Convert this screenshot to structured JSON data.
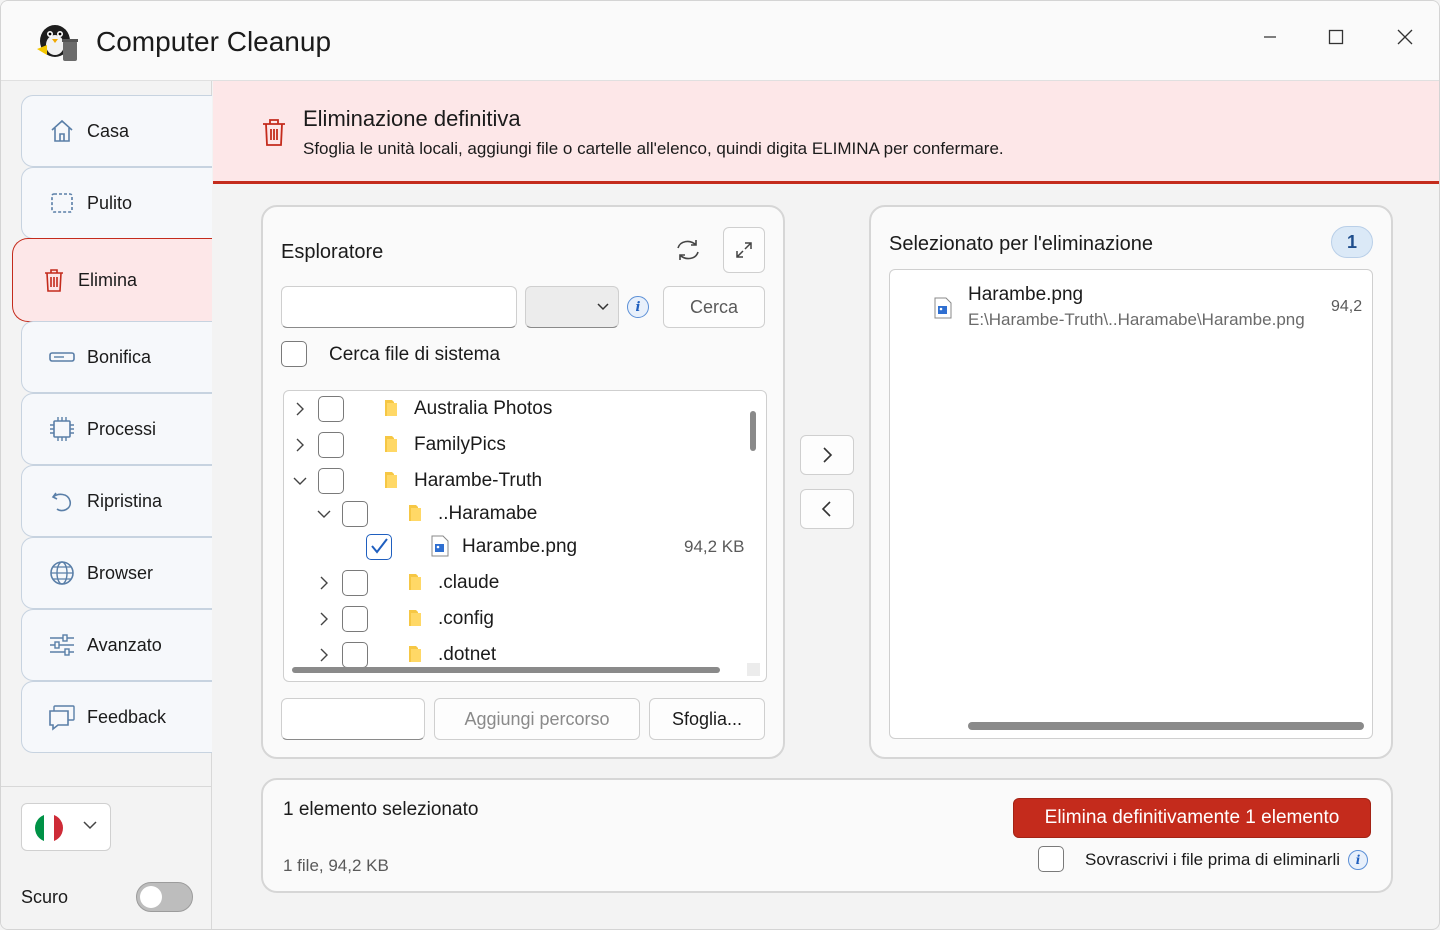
{
  "app": {
    "title": "Computer Cleanup",
    "window_controls": {
      "minimize": "minimize-icon",
      "maximize": "maximize-icon",
      "close": "close-icon"
    }
  },
  "sidebar": {
    "items": [
      {
        "label": "Casa",
        "icon": "home-icon"
      },
      {
        "label": "Pulito",
        "icon": "clean-icon"
      },
      {
        "label": "Elimina",
        "icon": "trash-icon",
        "active": true
      },
      {
        "label": "Bonifica",
        "icon": "drive-icon"
      },
      {
        "label": "Processi",
        "icon": "chip-icon"
      },
      {
        "label": "Ripristina",
        "icon": "restore-icon"
      },
      {
        "label": "Browser",
        "icon": "globe-icon"
      },
      {
        "label": "Avanzato",
        "icon": "sliders-icon"
      },
      {
        "label": "Feedback",
        "icon": "feedback-icon"
      }
    ],
    "language": {
      "selected": "it",
      "flag_icon": "italy-flag-icon"
    },
    "dark_mode": {
      "label": "Scuro",
      "on": false
    }
  },
  "banner": {
    "title": "Eliminazione definitiva",
    "subtitle": "Sfoglia le unità locali, aggiungi file o cartelle all'elenco, quindi digita ELIMINA per confermare.",
    "accent": "#c42b1c",
    "background": "#fde7e8"
  },
  "explorer": {
    "title": "Esploratore",
    "search_placeholder": "",
    "search_button": "Cerca",
    "system_files_label": "Cerca file di sistema",
    "tree": [
      {
        "label": "Australia Photos",
        "type": "folder",
        "expanded": false,
        "checked": false
      },
      {
        "label": "FamilyPics",
        "type": "folder",
        "expanded": false,
        "checked": false
      },
      {
        "label": "Harambe-Truth",
        "type": "folder",
        "expanded": true,
        "checked": false
      },
      {
        "label": "..Haramabe",
        "type": "folder",
        "expanded": true,
        "checked": false
      },
      {
        "label": "Harambe.png",
        "type": "file",
        "size": "94,2 KB",
        "checked": true
      },
      {
        "label": ".claude",
        "type": "folder",
        "expanded": false,
        "checked": false
      },
      {
        "label": ".config",
        "type": "folder",
        "expanded": false,
        "checked": false
      },
      {
        "label": ".dotnet",
        "type": "folder",
        "expanded": false,
        "checked": false
      }
    ],
    "path_input_value": "",
    "add_path_button": "Aggiungi percorso",
    "browse_button": "Sfoglia..."
  },
  "transfer": {
    "add": "chevron-right-icon",
    "remove": "chevron-left-icon"
  },
  "selected": {
    "title": "Selezionato per l'eliminazione",
    "count": "1",
    "items": [
      {
        "name": "Harambe.png",
        "path": "E:\\Harambe-Truth\\..Haramabe\\Harambe.png",
        "size": "94,2"
      }
    ]
  },
  "footer": {
    "summary": "1 elemento selezionato",
    "details": "1 file, 94,2 KB",
    "delete_button": "Elimina definitivamente 1 elemento",
    "overwrite_label": "Sovrascrivi i file prima di eliminarli"
  }
}
